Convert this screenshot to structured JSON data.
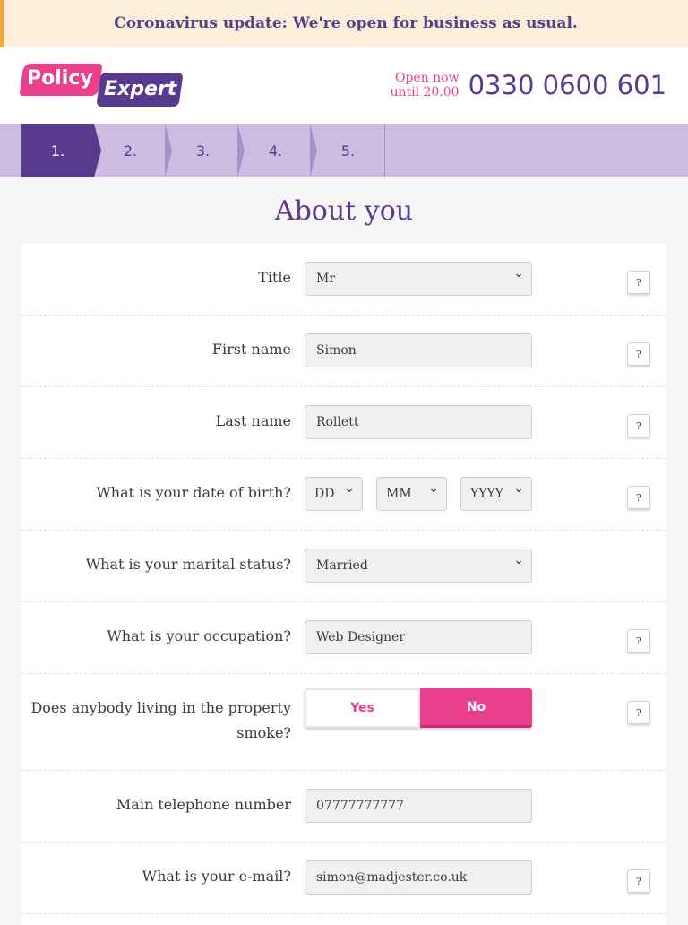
{
  "banner": {
    "text": "Coronavirus update: We're open for business as usual."
  },
  "header": {
    "logo_word1": "Policy",
    "logo_word2": "Expert",
    "hours_line1": "Open now",
    "hours_line2": "until 20.00",
    "phone": "0330 0600 601"
  },
  "steps": [
    "1.",
    "2.",
    "3.",
    "4.",
    "5."
  ],
  "page_title": "About you",
  "form": {
    "title": {
      "label": "Title",
      "value": "Mr"
    },
    "first_name": {
      "label": "First name",
      "value": "Simon"
    },
    "last_name": {
      "label": "Last name",
      "value": "Rollett"
    },
    "dob": {
      "label": "What is your date of birth?",
      "day": "DD",
      "month": "MM",
      "year": "YYYY"
    },
    "marital": {
      "label": "What is your marital status?",
      "value": "Married"
    },
    "occupation": {
      "label": "What is your occupation?",
      "value": "Web Designer"
    },
    "smoke": {
      "label": "Does anybody living in the property smoke?",
      "yes": "Yes",
      "no": "No",
      "selected": "No"
    },
    "phone": {
      "label": "Main telephone number",
      "value": "07777777777"
    },
    "email": {
      "label": "What is your e-mail?",
      "value": "simon@madjester.co.uk"
    },
    "help_label": "?"
  },
  "colors": {
    "brand_purple": "#583a8e",
    "brand_pink": "#ea3f8d",
    "banner_bg": "#fdeed9"
  }
}
